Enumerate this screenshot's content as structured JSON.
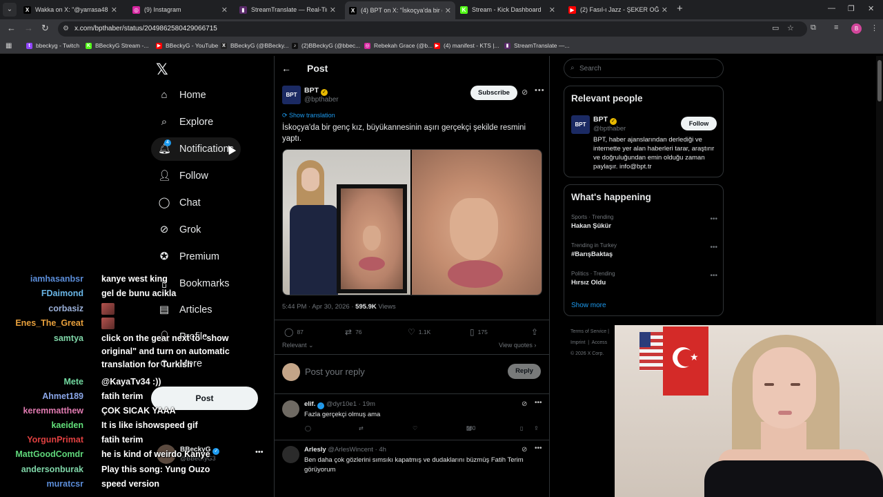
{
  "browser": {
    "tabs": [
      {
        "title": "Wakka on X: \"@yarrasa48 @BB",
        "fav": "X",
        "fav_color": "#000000"
      },
      {
        "title": "(9) Instagram",
        "fav": "◎",
        "fav_color": "#d6249f"
      },
      {
        "title": "StreamTranslate — Real-Tim",
        "fav": "▮",
        "fav_color": "#5a2a6a"
      },
      {
        "title": "(4) BPT on X: \"İskoçya'da bir ge",
        "fav": "X",
        "fav_color": "#000000"
      },
      {
        "title": "Stream - Kick Dashboard",
        "fav": "K",
        "fav_color": "#53fc18"
      },
      {
        "title": "(2) Fasıl-ı Jazz - ŞEKER OĞLAN",
        "fav": "▶",
        "fav_color": "#ff0000"
      }
    ],
    "url": "x.com/bpthaber/status/2049862580429066715",
    "profile_initial": "B",
    "bookmarks": [
      {
        "label": "bbeckyg - Twitch",
        "fav": "t",
        "color": "#9146ff"
      },
      {
        "label": "BBeckyG Stream -...",
        "fav": "K",
        "color": "#53fc18"
      },
      {
        "label": "BBeckyG - YouTube",
        "fav": "▶",
        "color": "#ff0000"
      },
      {
        "label": "BBeckyG (@BBecky...",
        "fav": "X",
        "color": "#222222"
      },
      {
        "label": "(2)BBeckyG (@bbec...",
        "fav": "♪",
        "color": "#111111"
      },
      {
        "label": "Rebekah Grace (@b...",
        "fav": "◎",
        "color": "#d6249f"
      },
      {
        "label": "(4) manifest - KTS |...",
        "fav": "▶",
        "color": "#ff0000"
      },
      {
        "label": "StreamTranslate —...",
        "fav": "▮",
        "color": "#5a2a6a"
      }
    ]
  },
  "nav": {
    "items": [
      {
        "label": "Home",
        "icon": "home-icon",
        "glyph": "⌂"
      },
      {
        "label": "Explore",
        "icon": "search-icon",
        "glyph": "⌕"
      },
      {
        "label": "Notifications",
        "icon": "bell-icon",
        "glyph": "🔔︎"
      },
      {
        "label": "Follow",
        "icon": "add-person-icon",
        "glyph": "👤︎"
      },
      {
        "label": "Chat",
        "icon": "chat-icon",
        "glyph": "◯"
      },
      {
        "label": "Grok",
        "icon": "grok-icon",
        "glyph": "⊘"
      },
      {
        "label": "Premium",
        "icon": "premium-icon",
        "glyph": "✪"
      },
      {
        "label": "Bookmarks",
        "icon": "bookmark-icon",
        "glyph": "▯"
      },
      {
        "label": "Articles",
        "icon": "article-icon",
        "glyph": "▤"
      },
      {
        "label": "Profile",
        "icon": "profile-icon",
        "glyph": "👤︎"
      },
      {
        "label": "More",
        "icon": "more-circle-icon",
        "glyph": "⊙"
      }
    ],
    "notif_count": "4",
    "post_label": "Post",
    "account_name": "BBeckyG",
    "account_handle": "@BBeckyG3"
  },
  "post": {
    "header_title": "Post",
    "author_name": "BPT",
    "author_handle": "@bpthaber",
    "avatar_text": "BPT",
    "subscribe_label": "Subscribe",
    "show_translation": "Show translation",
    "text": "İskoçya'da bir genç kız, büyükannesinin aşırı gerçekçi şekilde resmini yaptı.",
    "time": "5:44 PM · Apr 30, 2026 · ",
    "views": "595.9K",
    "views_label": " Views",
    "replies": "87",
    "reposts": "76",
    "likes": "1.1K",
    "bookmarks": "175",
    "relevant_label": "Relevant ⌄",
    "view_quotes": "View quotes ›",
    "reply_placeholder": "Post your reply",
    "reply_button": "Reply"
  },
  "comments": [
    {
      "name": "elif.",
      "handle": "@dyr10e1 · 19m",
      "text": "Fazla gerçekçi olmuş ama",
      "views": "580"
    },
    {
      "name": "Arlesly",
      "handle": "@ArlesWincent · 4h",
      "text": "Ben daha çok gözlerini sımsıkı kapatmış ve dudaklarını büzmüş Fatih Terim görüyorum"
    }
  ],
  "sidebar": {
    "search_placeholder": "Search",
    "relevant_title": "Relevant people",
    "person_name": "BPT",
    "person_handle": "@bpthaber",
    "follow_label": "Follow",
    "person_bio": "BPT, haber ajanslarından derlediği ve internette yer alan haberleri tarar, araştırır ve doğruluğundan emin olduğu zaman paylaşır. info@bpt.tr",
    "happening_title": "What's happening",
    "trends": [
      {
        "context": "Sports · Trending",
        "name": "Hakan Şükür"
      },
      {
        "context": "Trending in Turkey",
        "name": "#BarışBaktaş"
      },
      {
        "context": "Politics · Trending",
        "name": "Hırsız Oldu"
      }
    ],
    "show_more": "Show more",
    "footer_1": "Terms of Service",
    "footer_2": "Imprint",
    "footer_3": "Access",
    "footer_4": "© 2026 X Corp."
  },
  "chat": [
    {
      "user": "iamhasanbsr",
      "color": "#5b8dd9",
      "msg": "kanye west king"
    },
    {
      "user": "FDaimond",
      "color": "#6ab7e8",
      "msg": "gel de bunu acikla"
    },
    {
      "user": "corbasiz",
      "color": "#9bb0d8",
      "msg": "",
      "emote": true
    },
    {
      "user": "Enes_The_Great",
      "color": "#e8a03c",
      "msg": "",
      "emote": true
    },
    {
      "user": "samtya",
      "color": "#7fd6a8",
      "msg": "click on the gear next to \"show original\" and turn on automatic translation for Turkish"
    },
    {
      "user": "Mete",
      "color": "#72d9a0",
      "msg": "@KayaTv34 :))"
    },
    {
      "user": "Ahmet189",
      "color": "#8aa6e8",
      "msg": "fatih terim"
    },
    {
      "user": "keremmatthew",
      "color": "#e07ab0",
      "msg": "ÇOK SICAK YAAA"
    },
    {
      "user": "kaeiden",
      "color": "#62e07a",
      "msg": "It is like ishowspeed gif"
    },
    {
      "user": "YorgunPrimat",
      "color": "#e04040",
      "msg": "fatih terim"
    },
    {
      "user": "MattGoodComdr",
      "color": "#5fd67a",
      "msg": "he is kind of weirdo Kanye"
    },
    {
      "user": "andersonburak",
      "color": "#7fd6a8",
      "msg": "Play this song: Yung Ouzo"
    },
    {
      "user": "muratcsr",
      "color": "#5b8dd9",
      "msg": "speed version"
    }
  ]
}
